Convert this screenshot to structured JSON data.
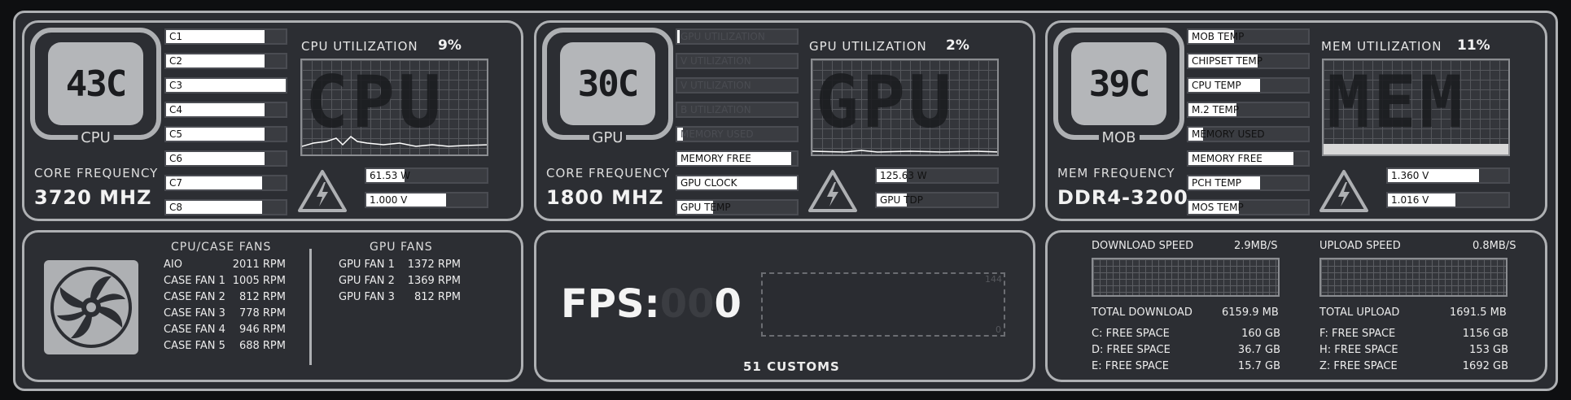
{
  "cpu": {
    "temp": "43C",
    "label": "CPU",
    "freq_label": "CORE FREQUENCY",
    "freq_value": "3720 MHZ",
    "util_title": "CPU UTILIZATION",
    "util_value": "9%",
    "graph_text": "CPU",
    "power": "61.53 W",
    "power_level": 0.32,
    "voltage": "1.000 V",
    "voltage_level": 0.66,
    "cores": [
      {
        "label": "C1",
        "level": 0.82
      },
      {
        "label": "C2",
        "level": 0.82
      },
      {
        "label": "C3",
        "level": 1.0
      },
      {
        "label": "C4",
        "level": 0.82
      },
      {
        "label": "C5",
        "level": 0.82
      },
      {
        "label": "C6",
        "level": 0.82
      },
      {
        "label": "C7",
        "level": 0.8
      },
      {
        "label": "C8",
        "level": 0.8
      }
    ]
  },
  "gpu": {
    "temp": "30C",
    "label": "GPU",
    "freq_label": "CORE FREQUENCY",
    "freq_value": "1800 MHZ",
    "util_title": "GPU UTILIZATION",
    "util_value": "2%",
    "graph_text": "GPU",
    "power": "125.63 W",
    "power_level": 0.25,
    "voltage": "GPU TDP",
    "voltage_level": 0.25,
    "stats": [
      {
        "label": "GPU UTILIZATION",
        "level": 0.02
      },
      {
        "label": "V UTILIZATION",
        "level": 0.0
      },
      {
        "label": "V UTILIZATION",
        "level": 0.0
      },
      {
        "label": "B UTILIZATION",
        "level": 0.0
      },
      {
        "label": "MEMORY USED",
        "level": 0.05
      },
      {
        "label": "MEMORY FREE",
        "level": 0.95
      },
      {
        "label": "GPU CLOCK",
        "level": 1.0
      },
      {
        "label": "GPU TEMP",
        "level": 0.3
      }
    ]
  },
  "mob": {
    "temp": "39C",
    "label": "MOB",
    "freq_label": "MEM FREQUENCY",
    "freq_value": "DDR4-3200",
    "util_title": "MEM UTILIZATION",
    "util_value": "11%",
    "graph_text": "MEM",
    "voltage1": "1.360 V",
    "voltage1_level": 0.76,
    "voltage2": "1.016 V",
    "voltage2_level": 0.56,
    "stats": [
      {
        "label": "MOB TEMP",
        "level": 0.38
      },
      {
        "label": "CHIPSET TEMP",
        "level": 0.58
      },
      {
        "label": "CPU TEMP",
        "level": 0.6
      },
      {
        "label": "M.2 TEMP",
        "level": 0.4
      },
      {
        "label": "MEMORY USED",
        "level": 0.12
      },
      {
        "label": "MEMORY FREE",
        "level": 0.88
      },
      {
        "label": "PCH TEMP",
        "level": 0.6
      },
      {
        "label": "MOS TEMP",
        "level": 0.42
      }
    ]
  },
  "fans": {
    "cpu_case_title": "CPU/CASE FANS",
    "cpu_case": [
      {
        "name": "AIO",
        "rpm": "2011 RPM"
      },
      {
        "name": "CASE FAN 1",
        "rpm": "1005 RPM"
      },
      {
        "name": "CASE FAN 2",
        "rpm": "812 RPM"
      },
      {
        "name": "CASE FAN 3",
        "rpm": "778 RPM"
      },
      {
        "name": "CASE FAN 4",
        "rpm": "946 RPM"
      },
      {
        "name": "CASE FAN 5",
        "rpm": "688 RPM"
      }
    ],
    "gpu_title": "GPU FANS",
    "gpu": [
      {
        "name": "GPU FAN 1",
        "rpm": "1372 RPM"
      },
      {
        "name": "GPU FAN 2",
        "rpm": "1369 RPM"
      },
      {
        "name": "GPU FAN 3",
        "rpm": "812 RPM"
      }
    ]
  },
  "fps": {
    "label": "FPS:",
    "ghost": "00",
    "value": "0",
    "scale_max": "144",
    "scale_min": "0",
    "footer": "51 CUSTOMS"
  },
  "network": {
    "download_label": "DOWNLOAD SPEED",
    "download_value": "2.9MB/S",
    "upload_label": "UPLOAD SPEED",
    "upload_value": "0.8MB/S",
    "total_download_label": "TOTAL DOWNLOAD",
    "total_download_value": "6159.9 MB",
    "total_upload_label": "TOTAL UPLOAD",
    "total_upload_value": "1691.5 MB",
    "drives_left": [
      {
        "name": "C: FREE SPACE",
        "value": "160 GB"
      },
      {
        "name": "D: FREE SPACE",
        "value": "36.7 GB"
      },
      {
        "name": "E: FREE SPACE",
        "value": "15.7 GB"
      }
    ],
    "drives_right": [
      {
        "name": "F: FREE SPACE",
        "value": "1156 GB"
      },
      {
        "name": "H: FREE SPACE",
        "value": "153 GB"
      },
      {
        "name": "Z: FREE SPACE",
        "value": "1692 GB"
      }
    ]
  }
}
